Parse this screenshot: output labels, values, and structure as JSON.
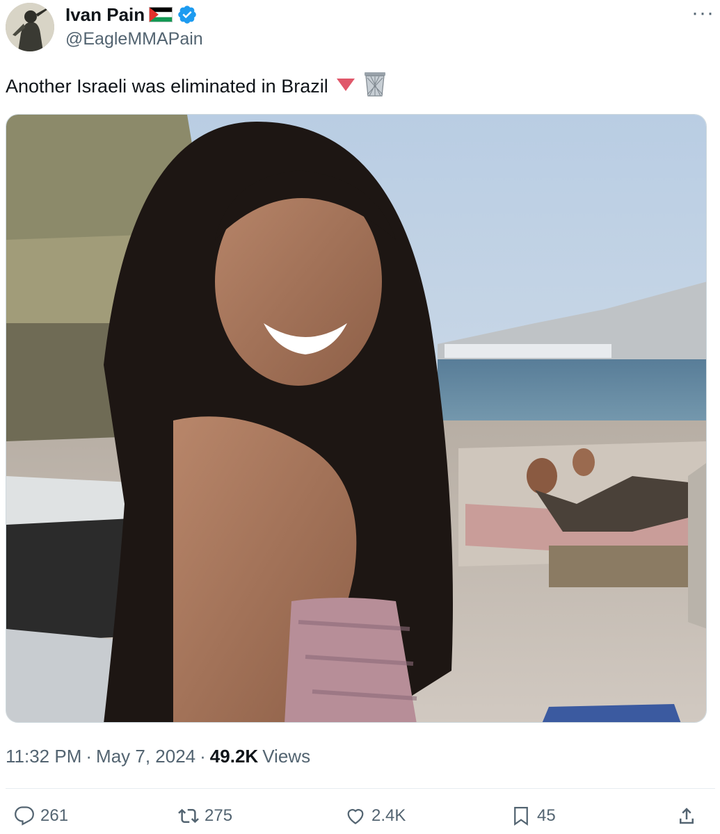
{
  "author": {
    "display_name": "Ivan Pain",
    "handle": "@EagleMMAPain",
    "verified": true,
    "flag": "palestine-flag",
    "avatar": "profile-avatar"
  },
  "menu": {
    "more_label": "···"
  },
  "tweet": {
    "text": "Another Israeli was eliminated in Brazil",
    "emojis": [
      "red-triangle-down-icon",
      "wastebasket-icon"
    ]
  },
  "media": {
    "kind": "photo",
    "subject": "beach-photo"
  },
  "meta": {
    "time": "11:32 PM",
    "separator": "·",
    "date": "May 7, 2024",
    "views_count": "49.2K",
    "views_label": "Views"
  },
  "actions": {
    "replies": "261",
    "reposts": "275",
    "likes": "2.4K",
    "bookmarks": "45"
  },
  "colors": {
    "text_primary": "#0f1419",
    "text_secondary": "#536471",
    "verified_blue": "#1d9bf0",
    "border": "#cfd9de"
  }
}
